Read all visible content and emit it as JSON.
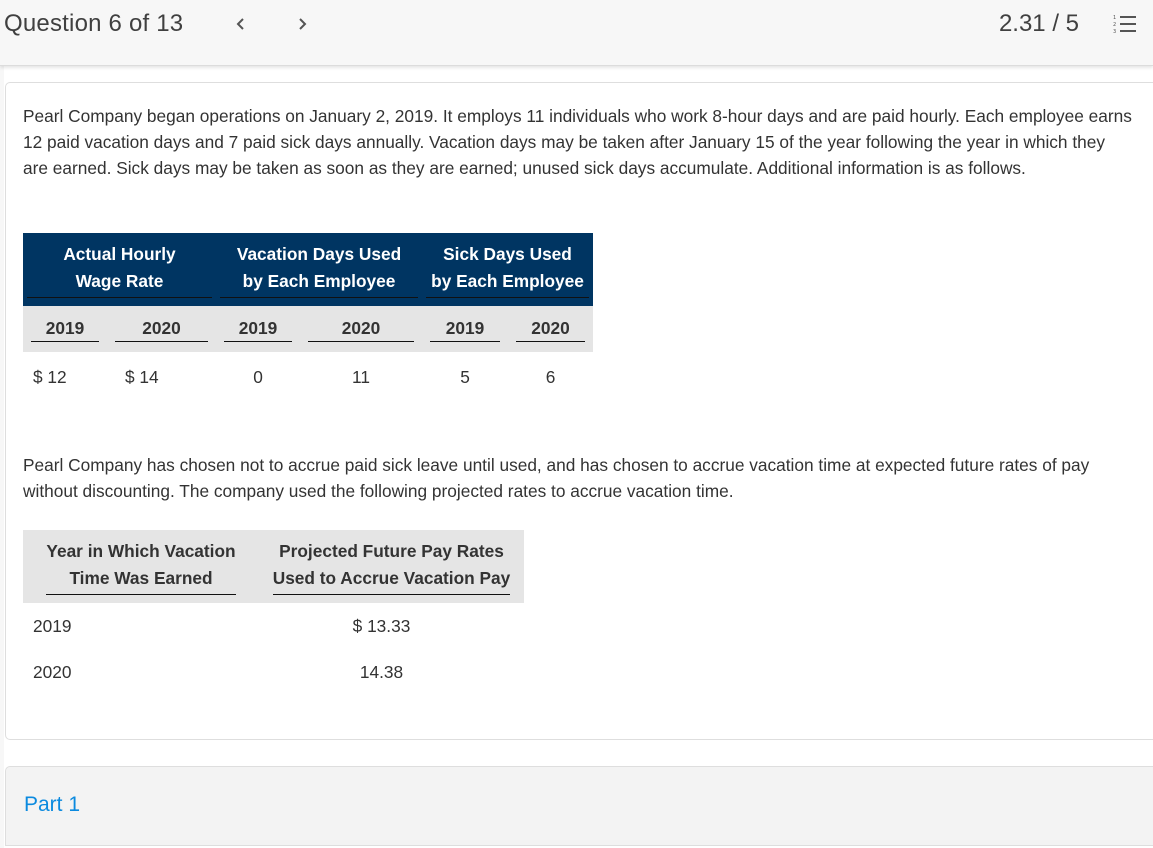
{
  "header": {
    "question_counter": "Question 6 of 13",
    "prev_icon": "chevron-left-icon",
    "next_icon": "chevron-right-icon",
    "score": "2.31 / 5",
    "list_icon": "numbered-list-icon"
  },
  "question": {
    "intro": "Pearl Company began operations on January 2, 2019. It employs  11 individuals who work 8-hour days and are paid hourly. Each employee earns  12 paid vacation days and  7 paid sick days annually. Vacation days may be taken after January 15 of the year following the year in which they are earned. Sick days may be taken as soon as they are earned; unused sick days accumulate. Additional information is as follows.",
    "table1": {
      "group_headers": [
        {
          "line1": "Actual Hourly",
          "line2": "Wage Rate"
        },
        {
          "line1": "Vacation Days Used",
          "line2": "by Each Employee"
        },
        {
          "line1": "Sick Days Used",
          "line2": "by Each Employee"
        }
      ],
      "years": [
        "2019",
        "2020",
        "2019",
        "2020",
        "2019",
        "2020"
      ],
      "values": [
        "$ 12",
        "$ 14",
        "0",
        "11",
        "5",
        "6"
      ]
    },
    "policy": "Pearl Company has chosen not to accrue paid sick leave until used, and has chosen to accrue vacation time at expected future rates of pay without discounting. The company used the following projected rates to accrue vacation time.",
    "table2": {
      "headers": [
        {
          "line1": "Year in Which Vacation",
          "line2": "Time Was Earned"
        },
        {
          "line1": "Projected Future Pay Rates",
          "line2": "Used to Accrue Vacation Pay"
        }
      ],
      "rows": [
        {
          "year": "2019",
          "rate": "$ 13.33"
        },
        {
          "year": "2020",
          "rate": "14.38"
        }
      ]
    }
  },
  "part": {
    "label": "Part 1",
    "color": "#0b8adf"
  },
  "colors": {
    "table_header_bg": "#003562",
    "subheader_bg": "#e5e5e5"
  }
}
